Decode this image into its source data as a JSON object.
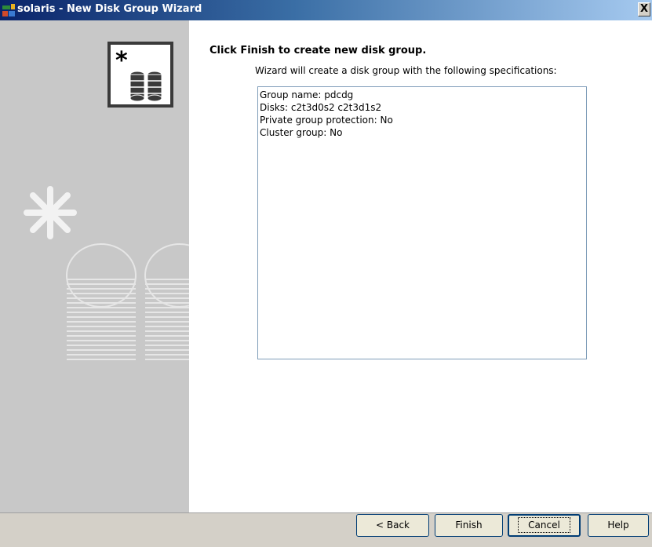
{
  "window": {
    "title": "solaris - New Disk Group Wizard",
    "close_label": "X"
  },
  "sidebar": {
    "icon": "disk-group-new-icon",
    "watermark": "disk-group-watermark-icon"
  },
  "main": {
    "heading": "Click Finish to create new disk group.",
    "subheading": "Wizard will create a disk group with the following specifications:",
    "specs": [
      "Group name: pdcdg",
      "Disks: c2t3d0s2 c2t3d1s2",
      "Private group protection: No",
      "Cluster group: No"
    ]
  },
  "buttons": {
    "back": "< Back",
    "finish": "Finish",
    "cancel": "Cancel",
    "help": "Help"
  }
}
